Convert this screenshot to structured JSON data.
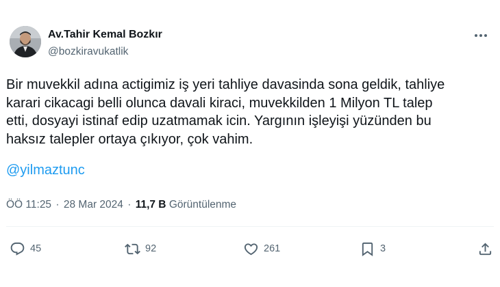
{
  "author": {
    "display_name": "Av.Tahir Kemal Bozkır",
    "handle": "@bozkiravukatlik"
  },
  "tweet": {
    "lines": [
      "Bir muvekkil adına actigimiz iş yeri tahliye davasinda sona geldik, tahliye",
      "karari cikacagi belli olunca davali kiraci, muvekkilden 1 Milyon TL talep",
      "etti, dosyayi istinaf edip uzatmamak icin. Yargının işleyişi yüzünden bu",
      "haksız talepler ortaya çıkıyor, çok vahim."
    ],
    "mention": "@yilmaztunc"
  },
  "meta": {
    "time": "ÖÖ 11:25",
    "separator": "·",
    "date": "28 Mar 2024",
    "views_count": "11,7 B",
    "views_label": "Görüntülenme"
  },
  "actions": {
    "replies": "45",
    "retweets": "92",
    "likes": "261",
    "bookmarks": "3"
  },
  "colors": {
    "text": "#0f1419",
    "secondary": "#536471",
    "link": "#1d9bf0",
    "divider": "#eff3f4"
  }
}
